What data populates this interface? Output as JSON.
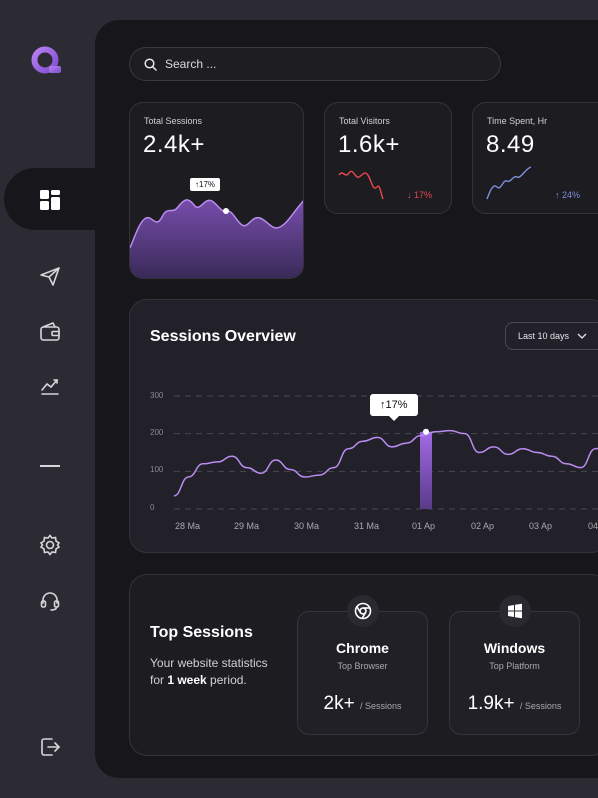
{
  "colors": {
    "accent": "#9b6bd3",
    "red": "#e5484d",
    "blue": "#7f8fdc"
  },
  "sidebar": {
    "logo_icon": "logo-q-icon",
    "items": [
      {
        "name": "dashboard",
        "icon": "grid-icon"
      },
      {
        "name": "send",
        "icon": "send-icon"
      },
      {
        "name": "wallet",
        "icon": "wallet-icon"
      },
      {
        "name": "analytics",
        "icon": "trend-icon"
      },
      {
        "name": "divider"
      },
      {
        "name": "settings",
        "icon": "gear-icon"
      },
      {
        "name": "support",
        "icon": "headset-icon"
      },
      {
        "name": "logout",
        "icon": "logout-icon"
      }
    ]
  },
  "search": {
    "placeholder": "Search ..."
  },
  "stats": [
    {
      "label": "Total Sessions",
      "value": "2.4k+",
      "badge": "↑17%"
    },
    {
      "label": "Total Visitors",
      "value": "1.6k+",
      "delta": "↓ 17%"
    },
    {
      "label": "Time Spent, Hr",
      "value": "8.49",
      "delta": "↑ 24%"
    }
  ],
  "overview": {
    "title": "Sessions Overview",
    "range": "Last 10 days",
    "tooltip": "↑17%"
  },
  "chart_data": {
    "type": "line",
    "title": "Sessions Overview",
    "x": [
      "28 Ma",
      "29 Ma",
      "30 Ma",
      "31 Ma",
      "01 Ap",
      "02 Ap",
      "03 Ap",
      "04"
    ],
    "y_ticks": [
      "300",
      "200",
      "100",
      "0"
    ],
    "ylim": [
      0,
      300
    ],
    "series": [
      {
        "values": [
          35,
          85,
          120,
          125,
          140,
          110,
          95,
          130,
          105,
          85,
          90,
          110,
          160,
          180,
          190,
          165,
          175,
          195,
          205,
          208,
          200,
          150,
          165,
          145,
          160,
          150,
          140,
          120,
          110,
          160,
          175
        ]
      }
    ],
    "highlight": {
      "x": "01 Ap",
      "value": 205,
      "label": "↑17%"
    }
  },
  "top_sessions": {
    "title": "Top Sessions",
    "desc_pre": "Your website statistics for ",
    "desc_bold": "1 week",
    "desc_post": " period.",
    "cards": [
      {
        "name": "Chrome",
        "sub": "Top Browser",
        "value": "2k+",
        "unit": "/ Sessions",
        "icon": "chrome-icon"
      },
      {
        "name": "Windows",
        "sub": "Top Platform",
        "value": "1.9k+",
        "unit": "/ Sessions",
        "icon": "windows-icon"
      }
    ]
  }
}
